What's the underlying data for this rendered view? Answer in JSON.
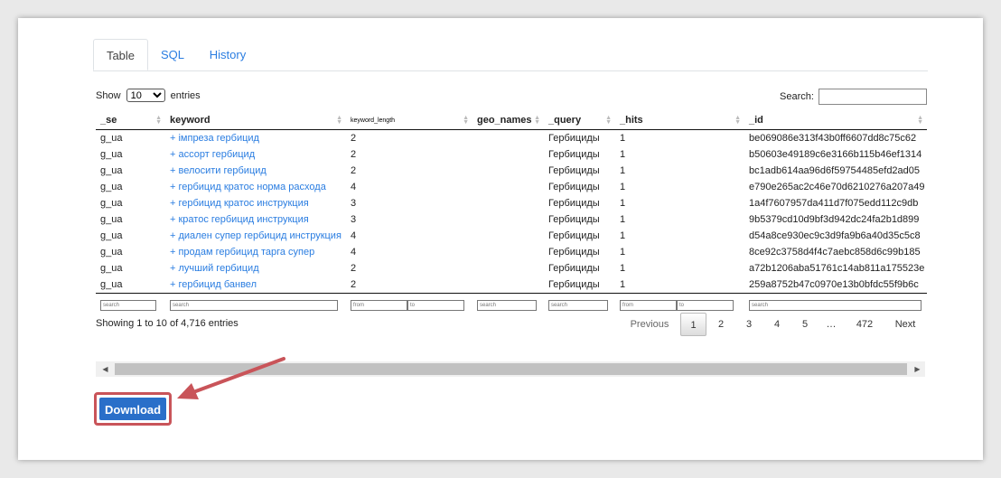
{
  "tabs": [
    {
      "label": "Table",
      "active": true
    },
    {
      "label": "SQL",
      "active": false
    },
    {
      "label": "History",
      "active": false
    }
  ],
  "length_control": {
    "show_label": "Show",
    "value": "10",
    "entries_label": "entries"
  },
  "search": {
    "label": "Search:",
    "value": ""
  },
  "table": {
    "columns": [
      "_se",
      "keyword",
      "keyword_length",
      "geo_names",
      "_query",
      "_hits",
      "_id"
    ],
    "rows": [
      [
        "g_ua",
        "+ імпреза гербицид",
        "2",
        "",
        "Гербициды",
        "1",
        "be069086e313f43b0ff6607dd8c75c62"
      ],
      [
        "g_ua",
        "+ ассорт гербицид",
        "2",
        "",
        "Гербициды",
        "1",
        "b50603e49189c6e3166b115b46ef1314"
      ],
      [
        "g_ua",
        "+ велосити гербицид",
        "2",
        "",
        "Гербициды",
        "1",
        "bc1adb614aa96d6f59754485efd2ad05"
      ],
      [
        "g_ua",
        "+ гербицид кратос норма расхода",
        "4",
        "",
        "Гербициды",
        "1",
        "e790e265ac2c46e70d6210276a207a49"
      ],
      [
        "g_ua",
        "+ гербицид кратос инструкция",
        "3",
        "",
        "Гербициды",
        "1",
        "1a4f7607957da411d7f075edd112c9db"
      ],
      [
        "g_ua",
        "+ кратос гербицид инструкция",
        "3",
        "",
        "Гербициды",
        "1",
        "9b5379cd10d9bf3d942dc24fa2b1d899"
      ],
      [
        "g_ua",
        "+ диален супер гербицид инструкция",
        "4",
        "",
        "Гербициды",
        "1",
        "d54a8ce930ec9c3d9fa9b6a40d35c5c8"
      ],
      [
        "g_ua",
        "+ продам гербицид тарга супер",
        "4",
        "",
        "Гербициды",
        "1",
        "8ce92c3758d4f4c7aebc858d6c99b185"
      ],
      [
        "g_ua",
        "+ лучший гербицид",
        "2",
        "",
        "Гербициды",
        "1",
        "a72b1206aba51761c14ab811a175523e"
      ],
      [
        "g_ua",
        "+ гербицид банвел",
        "2",
        "",
        "Гербициды",
        "1",
        "259a8752b47c0970e13b0bfdc55f9b6c"
      ]
    ],
    "filters": {
      "search_placeholder": "search",
      "from_placeholder": "from",
      "to_placeholder": "to"
    }
  },
  "info": "Showing 1 to 10 of 4,716 entries",
  "pagination": {
    "previous": "Previous",
    "pages": [
      "1",
      "2",
      "3",
      "4",
      "5",
      "…",
      "472"
    ],
    "current": "1",
    "next": "Next"
  },
  "download_label": "Download",
  "colors": {
    "accent": "#2a7de1",
    "button": "#2a6fc9",
    "highlight": "#c95459"
  }
}
